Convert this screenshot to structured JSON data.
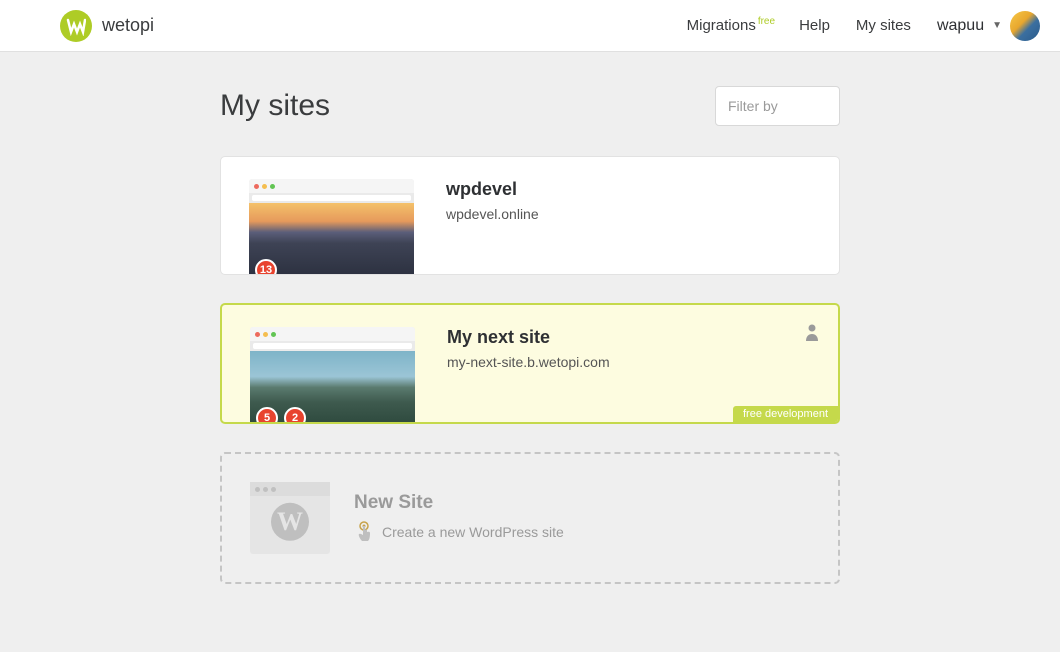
{
  "header": {
    "brand": "wetopi",
    "nav": {
      "migrations": "Migrations",
      "migrations_badge": "free",
      "help": "Help",
      "my_sites": "My sites"
    },
    "user": {
      "name": "wapuu"
    }
  },
  "page": {
    "title": "My sites",
    "filter_placeholder": "Filter by"
  },
  "sites": [
    {
      "title": "wpdevel",
      "domain": "wpdevel.online",
      "badges": [
        "13"
      ],
      "highlighted": false,
      "thumb_style": "sunset",
      "ribbon": null,
      "show_person": false
    },
    {
      "title": "My next site",
      "domain": "my-next-site.b.wetopi.com",
      "badges": [
        "5",
        "2"
      ],
      "highlighted": true,
      "thumb_style": "mountains",
      "ribbon": "free development",
      "show_person": true
    }
  ],
  "new_site": {
    "title": "New Site",
    "subtitle": "Create a new WordPress site"
  }
}
